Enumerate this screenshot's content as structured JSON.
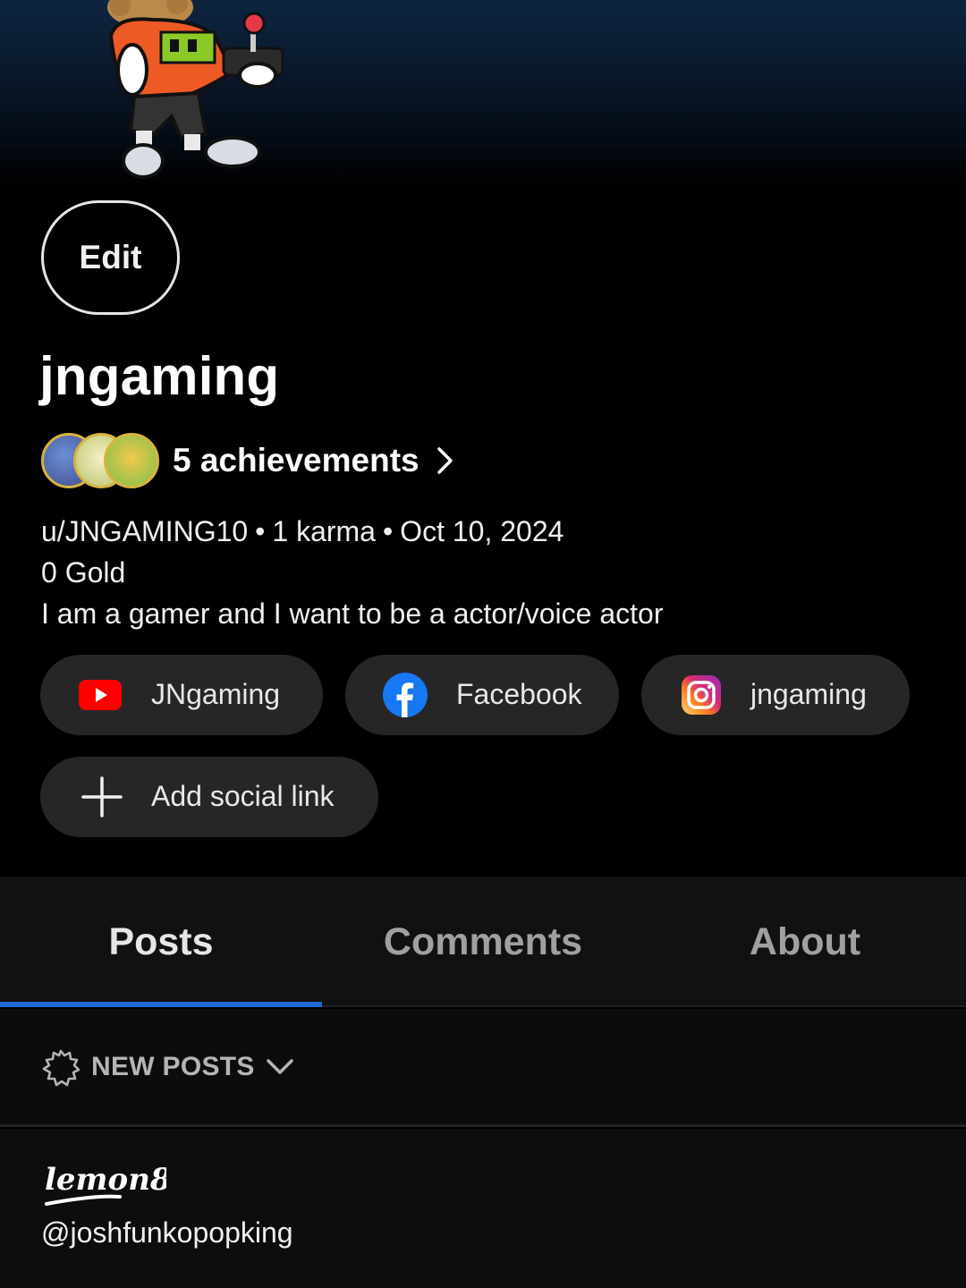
{
  "profile": {
    "edit_label": "Edit",
    "username": "jngaming",
    "achievements_label": "5 achievements",
    "handle": "u/JNGAMING10",
    "karma": "1 karma",
    "joined": "Oct 10, 2024",
    "separator": "•",
    "gold": "0 Gold",
    "bio": "I am a gamer and I want to be a actor/voice actor"
  },
  "social_links": [
    {
      "label": "JNgaming",
      "icon": "youtube-icon"
    },
    {
      "label": "Facebook",
      "icon": "facebook-icon"
    },
    {
      "label": "jngaming",
      "icon": "instagram-icon"
    }
  ],
  "add_social_label": "Add social link",
  "tabs": [
    {
      "label": "Posts",
      "active": true
    },
    {
      "label": "Comments",
      "active": false
    },
    {
      "label": "About",
      "active": false
    }
  ],
  "sort": {
    "label": "NEW POSTS",
    "icon": "new-burst-icon"
  },
  "watermark": {
    "logo_text": "lemon8",
    "handle": "@joshfunkopopking"
  },
  "colors": {
    "accent": "#1f6ad6",
    "chip_bg": "#262626",
    "youtube": "#ff0000",
    "facebook": "#1877f2"
  }
}
